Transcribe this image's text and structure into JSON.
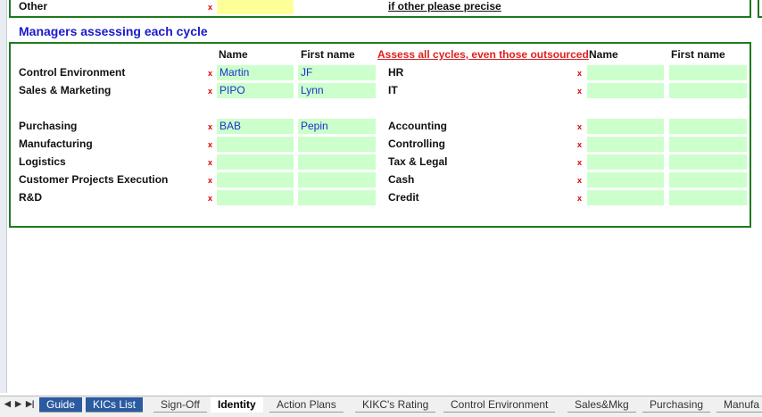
{
  "top": {
    "other_label": "Other",
    "mark": "x",
    "precise_label": "if other please precise"
  },
  "section_title": "Managers assessing each cycle",
  "headers": {
    "name": "Name",
    "first_name": "First name",
    "note": "Assess all cycles, even those outsourced"
  },
  "left_rows": [
    {
      "label": "Control Environment",
      "name": "Martin",
      "first": "JF"
    },
    {
      "label": "Sales & Marketing",
      "name": "PIPO",
      "first": "Lynn"
    },
    null,
    {
      "label": "Purchasing",
      "name": "BAB",
      "first": "Pepin"
    },
    {
      "label": "Manufacturing",
      "name": "",
      "first": ""
    },
    {
      "label": "Logistics",
      "name": "",
      "first": ""
    },
    {
      "label": "Customer Projects Execution",
      "name": "",
      "first": ""
    },
    {
      "label": "R&D",
      "name": "",
      "first": ""
    }
  ],
  "right_rows": [
    {
      "label": "HR",
      "name": "",
      "first": ""
    },
    {
      "label": "IT",
      "name": "",
      "first": ""
    },
    null,
    {
      "label": "Accounting",
      "name": "",
      "first": ""
    },
    {
      "label": "Controlling",
      "name": "",
      "first": ""
    },
    {
      "label": "Tax & Legal",
      "name": "",
      "first": ""
    },
    {
      "label": "Cash",
      "name": "",
      "first": ""
    },
    {
      "label": "Credit",
      "name": "",
      "first": ""
    }
  ],
  "sheet_tabs": [
    "Guide",
    "KICs List",
    "Sign-Off",
    "Identity",
    "Action Plans",
    "KIKC's Rating",
    "Control Environment",
    "Sales&Mkg",
    "Purchasing",
    "Manufa"
  ],
  "active_tab": "Identity",
  "colors": {
    "border": "#1e7a1e",
    "cell": "#ccffcc",
    "title": "#1a1acc",
    "note": "#e02020"
  }
}
